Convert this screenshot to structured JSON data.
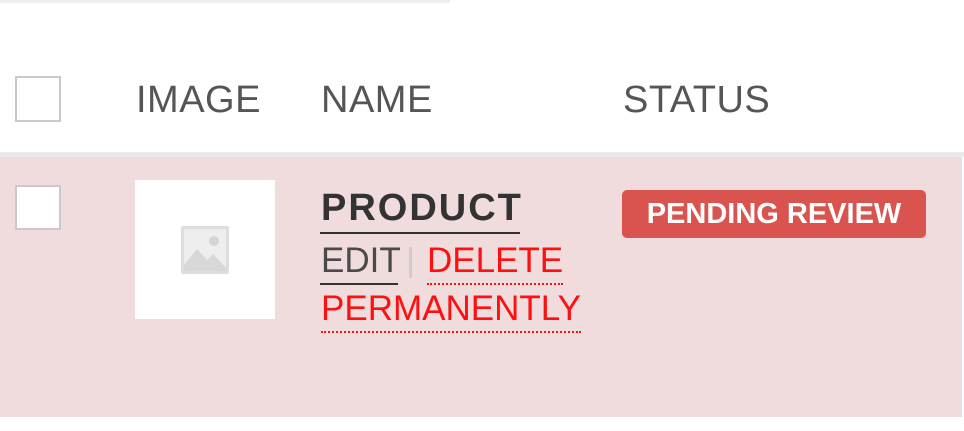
{
  "table": {
    "columns": {
      "image": "IMAGE",
      "name": "NAME",
      "status": "STATUS"
    },
    "rows": [
      {
        "name": "PRODUCT",
        "actions": {
          "edit": "EDIT",
          "separator": "|",
          "delete_line1": "DELETE",
          "delete_line2": "PERMANENTLY"
        },
        "status": "PENDING REVIEW",
        "image_icon": "image-placeholder-icon"
      }
    ]
  },
  "colors": {
    "row_background": "#f1dcdd",
    "status_badge": "#d9534f",
    "delete_link": "#ff1010"
  }
}
